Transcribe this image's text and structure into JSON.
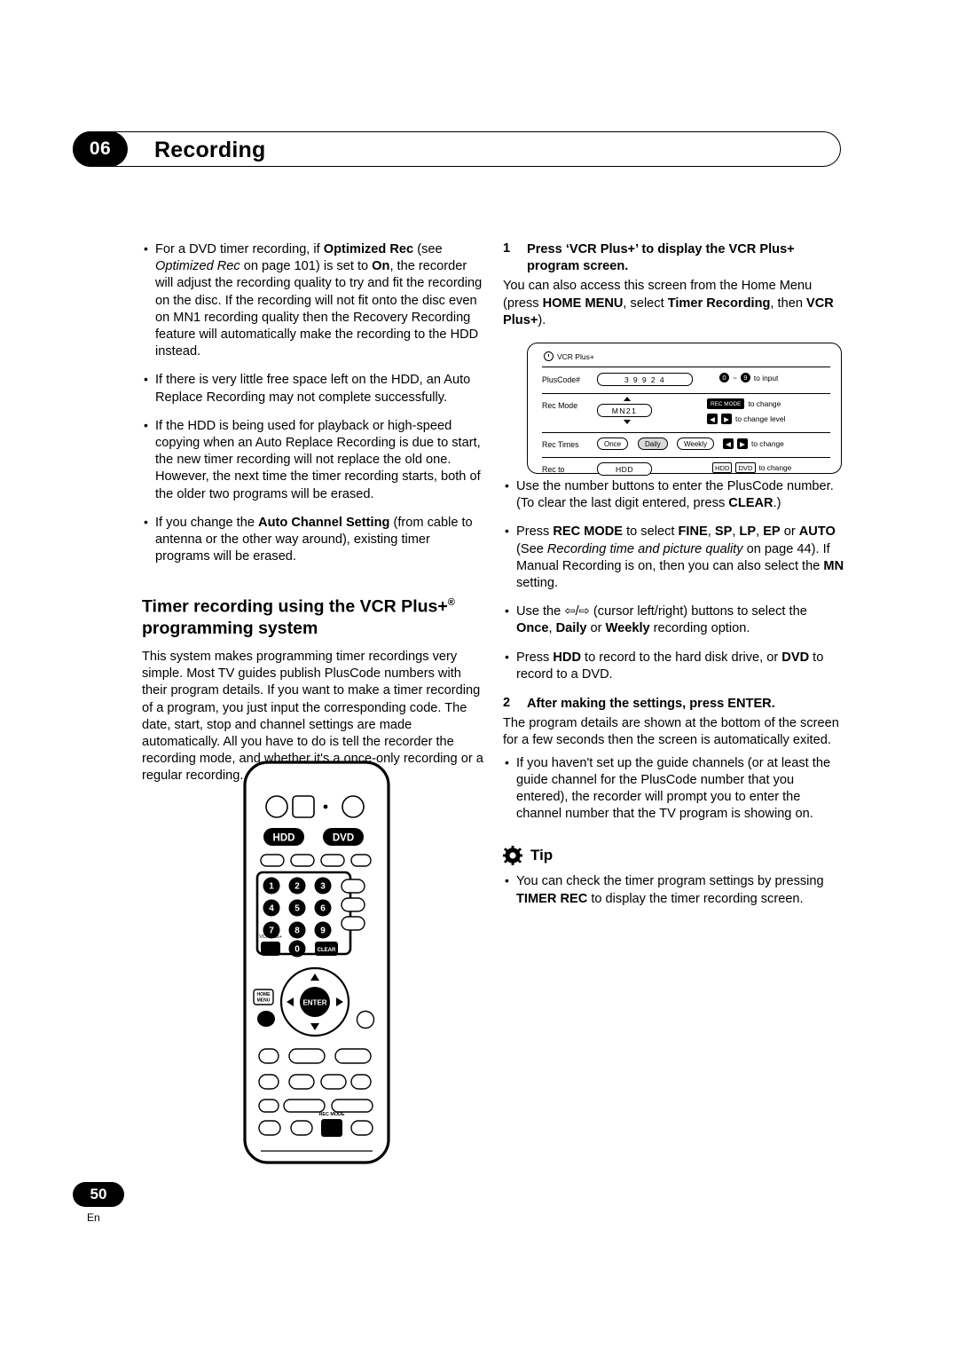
{
  "header": {
    "chapter_number": "06",
    "title": "Recording"
  },
  "left_column": {
    "bullets": [
      {
        "segments": [
          {
            "t": "For a DVD timer recording, if ",
            "s": "normal"
          },
          {
            "t": "Optimized Rec",
            "s": "bold"
          },
          {
            "t": " (see ",
            "s": "normal"
          },
          {
            "t": "Optimized Rec",
            "s": "italic"
          },
          {
            "t": " on page 101) is set to ",
            "s": "normal"
          },
          {
            "t": "On",
            "s": "bold"
          },
          {
            "t": ", the recorder will adjust the recording quality to try and fit the recording on the disc. If the recording will not fit onto the disc even on MN1 recording quality then the Recovery Recording feature will automatically make the recording to the HDD instead.",
            "s": "normal"
          }
        ]
      },
      {
        "segments": [
          {
            "t": "If there is very little free space left on the HDD, an Auto Replace Recording may not complete successfully.",
            "s": "normal"
          }
        ]
      },
      {
        "segments": [
          {
            "t": "If the HDD is being used for playback or high-speed copying when an Auto Replace Recording is due to start, the new timer recording will not replace the old one. However, the next time the timer recording starts, both of the older two programs will be erased.",
            "s": "normal"
          }
        ]
      },
      {
        "segments": [
          {
            "t": "If you change the ",
            "s": "normal"
          },
          {
            "t": "Auto Channel Setting",
            "s": "bold"
          },
          {
            "t": " (from cable to antenna or the other way around), existing timer programs will be erased.",
            "s": "normal"
          }
        ]
      }
    ],
    "section_heading_line1": "Timer recording using the VCR Plus+",
    "section_heading_sup": "®",
    "section_heading_line2": "programming system",
    "section_body": "This system makes programming timer recordings very simple. Most TV guides publish PlusCode numbers with their program details. If you want to make a timer recording of a program, you just input the corresponding code. The date, start, stop and channel settings are made automatically. All you have to do is tell the recorder the recording mode, and whether it's a once-only recording or a regular recording."
  },
  "remote": {
    "hdd_button": "HDD",
    "dvd_button": "DVD",
    "numbers": [
      "1",
      "2",
      "3",
      "4",
      "5",
      "6",
      "7",
      "8",
      "9",
      "0"
    ],
    "vcr_plus_label": "VCR Plus+",
    "clear_button": "CLEAR",
    "enter_button": "ENTER",
    "home_menu_button": "HOME MENU",
    "rec_mode_button": "REC MODE"
  },
  "right_column": {
    "step1": {
      "number": "1",
      "heading": "Press ‘VCR Plus+’ to display the VCR Plus+ program screen.",
      "body_segments": [
        {
          "t": "You can also access this screen from the Home Menu (press ",
          "s": "normal"
        },
        {
          "t": "HOME MENU",
          "s": "bold"
        },
        {
          "t": ", select ",
          "s": "normal"
        },
        {
          "t": "Timer Recording",
          "s": "bold"
        },
        {
          "t": ", then ",
          "s": "normal"
        },
        {
          "t": "VCR Plus+",
          "s": "bold"
        },
        {
          "t": ").",
          "s": "normal"
        }
      ]
    },
    "osd": {
      "title": "VCR Plus+",
      "rows": [
        {
          "label": "PlusCode#",
          "field_value": "3 9 9 2 4",
          "hint": "to input",
          "keys": [
            "0",
            "~",
            "9"
          ]
        },
        {
          "label": "Rec Mode",
          "field_value": "MN21",
          "hint1": "to change",
          "hint2": "to change level",
          "key_label": "REC MODE"
        },
        {
          "label": "Rec Times",
          "options": [
            "Once",
            "Daily",
            "Weekly"
          ],
          "selected_option": "Daily",
          "hint": "to change"
        },
        {
          "label": "Rec to",
          "field_value": "HDD",
          "hint": "to change",
          "keys": [
            "HDD",
            "DVD"
          ]
        }
      ]
    },
    "bullets_after_osd": [
      {
        "segments": [
          {
            "t": "Use the number buttons to enter the PlusCode number. (To clear the last digit entered, press ",
            "s": "normal"
          },
          {
            "t": "CLEAR",
            "s": "bold"
          },
          {
            "t": ".)",
            "s": "normal"
          }
        ]
      },
      {
        "segments": [
          {
            "t": "Press ",
            "s": "normal"
          },
          {
            "t": "REC MODE",
            "s": "bold"
          },
          {
            "t": " to select ",
            "s": "normal"
          },
          {
            "t": "FINE",
            "s": "bold"
          },
          {
            "t": ", ",
            "s": "normal"
          },
          {
            "t": "SP",
            "s": "bold"
          },
          {
            "t": ", ",
            "s": "normal"
          },
          {
            "t": "LP",
            "s": "bold"
          },
          {
            "t": ", ",
            "s": "normal"
          },
          {
            "t": "EP",
            "s": "bold"
          },
          {
            "t": " or ",
            "s": "normal"
          },
          {
            "t": "AUTO",
            "s": "bold"
          },
          {
            "t": " (See ",
            "s": "normal"
          },
          {
            "t": "Recording time and picture quality",
            "s": "italic"
          },
          {
            "t": " on page 44). If Manual Recording is on, then you can also select the ",
            "s": "normal"
          },
          {
            "t": "MN",
            "s": "bold"
          },
          {
            "t": " setting.",
            "s": "normal"
          }
        ]
      },
      {
        "segments": [
          {
            "t": "Use the ",
            "s": "normal"
          },
          {
            "t": "⇦/⇨",
            "s": "arrow"
          },
          {
            "t": " (cursor left/right) buttons to select the ",
            "s": "normal"
          },
          {
            "t": "Once",
            "s": "bold"
          },
          {
            "t": ", ",
            "s": "normal"
          },
          {
            "t": "Daily",
            "s": "bold"
          },
          {
            "t": " or ",
            "s": "normal"
          },
          {
            "t": "Weekly",
            "s": "bold"
          },
          {
            "t": " recording option.",
            "s": "normal"
          }
        ]
      },
      {
        "segments": [
          {
            "t": "Press ",
            "s": "normal"
          },
          {
            "t": "HDD",
            "s": "bold"
          },
          {
            "t": " to record to the hard disk drive, or ",
            "s": "normal"
          },
          {
            "t": "DVD",
            "s": "bold"
          },
          {
            "t": " to record to a DVD.",
            "s": "normal"
          }
        ]
      }
    ],
    "step2": {
      "number": "2",
      "heading": "After making the settings, press ENTER.",
      "body": "The program details are shown at the bottom of the screen for a few seconds then the screen is automatically exited."
    },
    "bullets_after_step2": [
      {
        "segments": [
          {
            "t": "If you haven't set up the guide channels (or at least the guide channel for the PlusCode number that you entered), the recorder will prompt you to enter the channel number that the TV program is showing on.",
            "s": "normal"
          }
        ]
      }
    ],
    "tip": {
      "label": "Tip",
      "bullets": [
        {
          "segments": [
            {
              "t": "You can check the timer program settings by pressing ",
              "s": "normal"
            },
            {
              "t": "TIMER REC",
              "s": "bold"
            },
            {
              "t": " to display the timer recording screen.",
              "s": "normal"
            }
          ]
        }
      ]
    }
  },
  "footer": {
    "page_number": "50",
    "language": "En"
  }
}
